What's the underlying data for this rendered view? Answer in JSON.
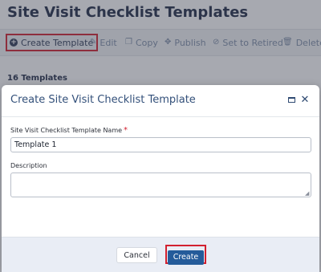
{
  "page": {
    "title": "Site Visit Checklist Templates",
    "template_count": "16 Templates"
  },
  "toolbar": {
    "create_label": "Create Template",
    "edit_label": "Edit",
    "copy_label": "Copy",
    "publish_label": "Publish",
    "retire_label": "Set to Retired",
    "delete_label": "Delete"
  },
  "modal": {
    "title": "Create Site Visit Checklist Template",
    "name_label": "Site Visit Checklist Template Name",
    "name_required_mark": "*",
    "name_value": "Template 1",
    "description_label": "Description",
    "description_value": "",
    "cancel_label": "Cancel",
    "create_label": "Create"
  },
  "icons": {
    "create": "plus-circle-icon",
    "edit": "pencil-icon",
    "copy": "copy-icon",
    "publish": "publish-icon",
    "retire": "ban-icon",
    "delete": "trash-icon",
    "maximize": "maximize-icon",
    "close": "close-icon"
  },
  "colors": {
    "highlight": "#d2202f",
    "primary_button": "#245b9a",
    "title_text": "#33507a"
  }
}
